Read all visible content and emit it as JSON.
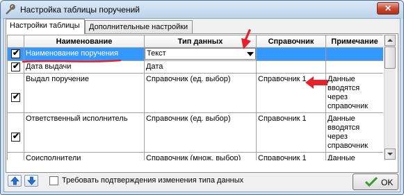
{
  "window": {
    "title": "Настройка таблицы поручений",
    "close_glyph": "✕",
    "icon": "tools-icon"
  },
  "tabs": [
    {
      "label": "Настройки таблицы",
      "active": true
    },
    {
      "label": "Дополнительные настройки",
      "active": false
    }
  ],
  "grid": {
    "columns": [
      "Наименование",
      "Тип данных",
      "Справочник",
      "Примечание"
    ],
    "rows": [
      {
        "checked": true,
        "name": "Наименование поручения",
        "type": "Текст",
        "reference": "",
        "note": "",
        "selected": true
      },
      {
        "checked": true,
        "name": "Дата выдачи",
        "type": "Дата",
        "reference": "",
        "note": ""
      },
      {
        "checked": true,
        "name": "Выдал поручение",
        "type": "Справочник (ед. выбор)",
        "reference": "Справочник 1",
        "note": "Данные вводятся через справочник"
      },
      {
        "checked": true,
        "name": "Ответственный исполнитель",
        "type": "Справочник (ед. выбор)",
        "reference": "Справочник 1",
        "note": "Данные вводятся через справочник"
      },
      {
        "checked": true,
        "name": "Соисполнители",
        "type": "Справочник (множ. выбор)",
        "reference": "Справочник 1",
        "note": "Данные вводятся через"
      }
    ]
  },
  "toolbar": {
    "move_up_icon": "arrow-up-icon",
    "move_down_icon": "arrow-down-icon",
    "confirm_label": "Требовать подтверждения изменения типа данных",
    "confirm_checked": false
  },
  "ok_button": {
    "label": "OK",
    "icon": "check-icon"
  },
  "colors": {
    "selection": "#3399ff",
    "annotation_red": "#e8202a",
    "title_bar": "#c9dcf0"
  }
}
